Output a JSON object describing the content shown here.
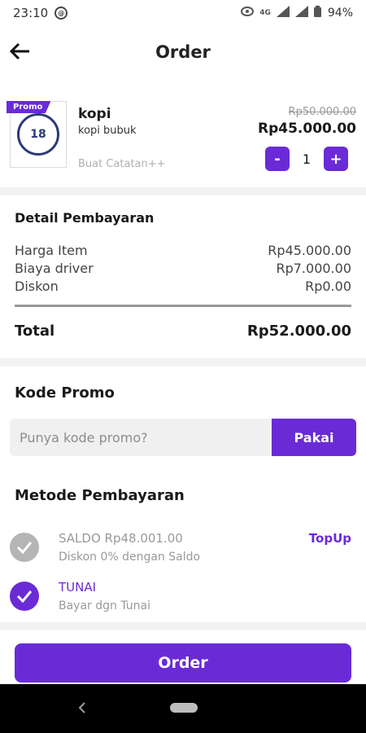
{
  "status_bar": {
    "time": "23:10",
    "network": "4G",
    "battery": "94%"
  },
  "header": {
    "title": "Order"
  },
  "product": {
    "badge": "Promo",
    "name": "kopi",
    "description": "kopi bubuk",
    "note_link": "Buat Catatan++",
    "old_price": "Rp50.000.00",
    "price": "Rp45.000.00",
    "quantity": "1",
    "decrease_label": "-",
    "increase_label": "+"
  },
  "payment_details": {
    "title": "Detail Pembayaran",
    "rows": [
      {
        "label": "Harga Item",
        "value": "Rp45.000.00"
      },
      {
        "label": "Biaya driver",
        "value": "Rp7.000.00"
      },
      {
        "label": "Diskon",
        "value": "Rp0.00"
      }
    ],
    "total_label": "Total",
    "total_value": "Rp52.000.00"
  },
  "promo": {
    "title": "Kode Promo",
    "placeholder": "Punya kode promo?",
    "apply_label": "Pakai"
  },
  "payment_method": {
    "title": "Metode Pembayaran",
    "options": [
      {
        "name": "SALDO Rp48.001.00",
        "subtitle": "Diskon 0% dengan Saldo",
        "selected": false,
        "action": "TopUp"
      },
      {
        "name": "TUNAI",
        "subtitle": "Bayar dgn Tunai",
        "selected": true
      }
    ]
  },
  "order_button": {
    "label": "Order"
  },
  "colors": {
    "accent": "#6a2bd6",
    "muted": "#9a9a9a",
    "disabled_check": "#b5b5b5"
  },
  "icons": {
    "back": "arrow-left-icon",
    "check": "check-icon",
    "nav_back": "nav-back-icon",
    "nav_home": "nav-home-icon"
  }
}
